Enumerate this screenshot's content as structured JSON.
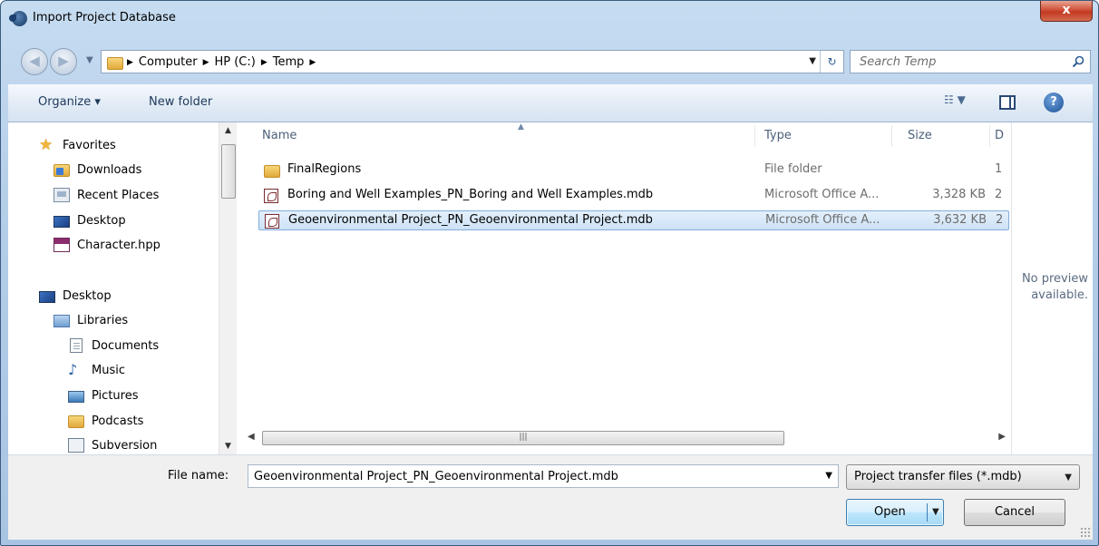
{
  "window": {
    "title": "Import Project Database",
    "close_label": "x"
  },
  "address": {
    "breadcrumbs": [
      "Computer",
      "HP (C:)",
      "Temp"
    ],
    "search_placeholder": "Search Temp"
  },
  "toolbar": {
    "organize_label": "Organize ▾",
    "new_folder_label": "New folder"
  },
  "nav": {
    "favorites": "Favorites",
    "favorites_items": [
      "Downloads",
      "Recent Places",
      "Desktop",
      "Character.hpp"
    ],
    "desktop": "Desktop",
    "libraries": "Libraries",
    "library_items": [
      "Documents",
      "Music",
      "Pictures",
      "Podcasts",
      "Subversion"
    ]
  },
  "columns": {
    "name": "Name",
    "type": "Type",
    "size": "Size",
    "date": "D"
  },
  "files": [
    {
      "name": "FinalRegions",
      "type": "File folder",
      "size": "",
      "date": "1",
      "icon": "folder-icon"
    },
    {
      "name": "Boring and Well Examples_PN_Boring and Well Examples.mdb",
      "type": "Microsoft Office A...",
      "size": "3,328 KB",
      "date": "2",
      "icon": "mdb-file-icon"
    },
    {
      "name": "Geoenvironmental Project_PN_Geoenvironmental Project.mdb",
      "type": "Microsoft Office A...",
      "size": "3,632 KB",
      "date": "2",
      "icon": "mdb-file-icon",
      "selected": true
    }
  ],
  "preview": {
    "line1": "No preview",
    "line2": "available."
  },
  "footer": {
    "file_name_label": "File name:",
    "file_name_value": "Geoenvironmental Project_PN_Geoenvironmental Project.mdb",
    "file_type_value": "Project transfer files (*.mdb)",
    "open_label": "Open",
    "cancel_label": "Cancel"
  },
  "colors": {
    "selection": "#cde2f7",
    "chrome": "#b4cde8",
    "close": "#c23a22"
  }
}
